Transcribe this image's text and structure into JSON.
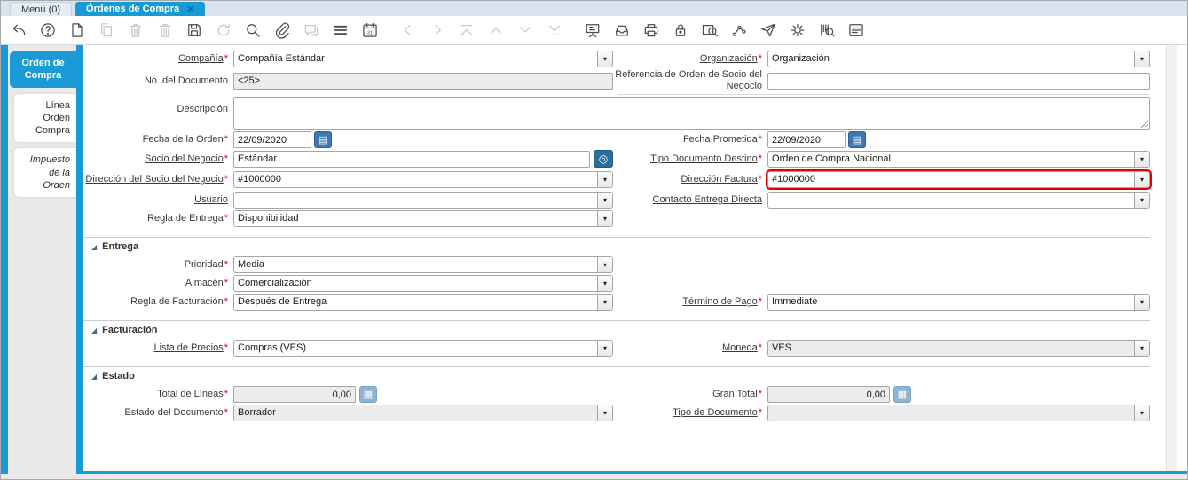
{
  "icons": {
    "close": "✕",
    "dropdown_arrow": "▾",
    "calendar": "▤",
    "calculator": "▦",
    "record_info": "◎",
    "section_collapse": "◢"
  },
  "colors": {
    "accent_blue": "#1a9bd7",
    "highlight_red": "#e60000"
  },
  "window_tabs": [
    {
      "label": "Menú (0)",
      "active": false
    },
    {
      "label": "Órdenes de Compra",
      "active": true
    }
  ],
  "toolbar": {
    "icons": [
      {
        "name": "undo",
        "disabled": false
      },
      {
        "name": "help",
        "disabled": false
      },
      {
        "name": "new-record",
        "disabled": false
      },
      {
        "name": "copy-record",
        "disabled": true
      },
      {
        "name": "delete-record",
        "disabled": true
      },
      {
        "name": "delete-selection",
        "disabled": true
      },
      {
        "name": "save",
        "disabled": false
      },
      {
        "name": "refresh",
        "disabled": true
      },
      {
        "name": "find",
        "disabled": false
      },
      {
        "name": "attachment",
        "disabled": false
      },
      {
        "name": "chat",
        "disabled": true
      },
      {
        "name": "grid-toggle",
        "disabled": false
      },
      {
        "name": "calendar",
        "disabled": false
      },
      {
        "name": "parent-record",
        "disabled": true,
        "gap": true
      },
      {
        "name": "detail-record",
        "disabled": true
      },
      {
        "name": "first-record",
        "disabled": true
      },
      {
        "name": "previous-record",
        "disabled": true
      },
      {
        "name": "next-record",
        "disabled": true
      },
      {
        "name": "last-record",
        "disabled": true
      },
      {
        "name": "report",
        "disabled": false,
        "gap": true
      },
      {
        "name": "archive",
        "disabled": false
      },
      {
        "name": "print",
        "disabled": false
      },
      {
        "name": "lock",
        "disabled": false
      },
      {
        "name": "record-info",
        "disabled": false
      },
      {
        "name": "workflow",
        "disabled": false
      },
      {
        "name": "request",
        "disabled": false
      },
      {
        "name": "process",
        "disabled": false
      },
      {
        "name": "product-info",
        "disabled": false
      },
      {
        "name": "quick-form",
        "disabled": false
      }
    ]
  },
  "sidebar": {
    "tabs": [
      {
        "label": "Orden de Compra",
        "active": true
      },
      {
        "label": "Línea Orden Compra",
        "active": false
      },
      {
        "label": "Impuesto de la Orden",
        "active": false,
        "italic": true
      }
    ]
  },
  "form": {
    "req": "*",
    "sections": {
      "entrega": "Entrega",
      "facturacion": "Facturación",
      "estado": "Estado"
    },
    "fields": {
      "compania": {
        "label": "Compañía",
        "value": "Compañía Estándar"
      },
      "organizacion": {
        "label": "Organización",
        "value": "Organización"
      },
      "no_documento": {
        "label": "No. del Documento",
        "value": "<25>"
      },
      "referencia": {
        "label": "Referencia de Orden de Socio del Negocio",
        "value": ""
      },
      "descripcion": {
        "label": "Descripción",
        "value": ""
      },
      "fecha_orden": {
        "label": "Fecha de la Orden",
        "value": "22/09/2020"
      },
      "fecha_prometida": {
        "label": "Fecha Prometida",
        "value": "22/09/2020"
      },
      "socio": {
        "label": "Socio del Negocio",
        "value": "Estándar"
      },
      "tipo_doc_destino": {
        "label": "Tipo Documento Destino",
        "value": "Orden de Compra Nacional"
      },
      "direccion_socio": {
        "label": "Dirección del Socio del Negocio",
        "value": "#1000000"
      },
      "direccion_factura": {
        "label": "Dirección Factura",
        "value": "#1000000"
      },
      "usuario": {
        "label": "Usuario",
        "value": ""
      },
      "contacto_entrega": {
        "label": "Contacto Entrega Directa",
        "value": ""
      },
      "regla_entrega": {
        "label": "Regla de Entrega",
        "value": "Disponibilidad"
      },
      "prioridad": {
        "label": "Prioridad",
        "value": "Media"
      },
      "almacen": {
        "label": "Almacén",
        "value": "Comercialización"
      },
      "regla_facturacion": {
        "label": "Regla de Facturación",
        "value": "Después de Entrega"
      },
      "termino_pago": {
        "label": "Término de Pago",
        "value": "Immediate"
      },
      "lista_precios": {
        "label": "Lista de Precios",
        "value": "Compras (VES)"
      },
      "moneda": {
        "label": "Moneda",
        "value": "VES"
      },
      "total_lineas": {
        "label": "Total de Líneas",
        "value": "0,00"
      },
      "gran_total": {
        "label": "Gran Total",
        "value": "0,00"
      },
      "estado_documento": {
        "label": "Estado del Documento",
        "value": "Borrador"
      },
      "tipo_documento": {
        "label": "Tipo de Documento",
        "value": ""
      }
    }
  }
}
